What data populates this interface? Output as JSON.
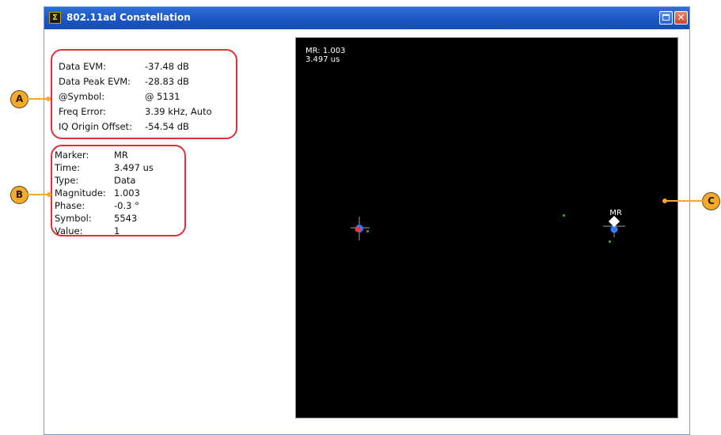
{
  "window": {
    "title": "802.11ad Constellation",
    "app_icon_glyph": "Σ"
  },
  "measurements": [
    {
      "label": "Data EVM:",
      "value": "-37.48 dB"
    },
    {
      "label": "Data Peak EVM:",
      "value": "-28.83 dB"
    },
    {
      "label": "@Symbol:",
      "value": "@ 5131"
    },
    {
      "label": "Freq Error:",
      "value": "3.39 kHz, Auto"
    },
    {
      "label": "IQ Origin Offset:",
      "value": "-54.54 dB"
    }
  ],
  "marker_info": [
    {
      "label": "Marker:",
      "value": "MR"
    },
    {
      "label": "Time:",
      "value": "3.497 us"
    },
    {
      "label": "Type:",
      "value": "Data"
    },
    {
      "label": "Magnitude:",
      "value": "1.003"
    },
    {
      "label": "Phase:",
      "value": "-0.3 °"
    },
    {
      "label": "Symbol:",
      "value": "5543"
    },
    {
      "label": "Value:",
      "value": "1"
    }
  ],
  "plot": {
    "readout_line1": "MR: 1.003",
    "readout_line2": "3.497 us",
    "marker_label": "MR",
    "colors": {
      "background": "#000000",
      "points_a": "#2f7bff",
      "points_b": "#ff3030",
      "ideal": "#2f9a2f",
      "crosshair": "#a0a0a0",
      "marker": "#ffffff"
    }
  },
  "callouts": {
    "a": "A",
    "b": "B",
    "c": "C",
    "color": "#f6a92d"
  }
}
